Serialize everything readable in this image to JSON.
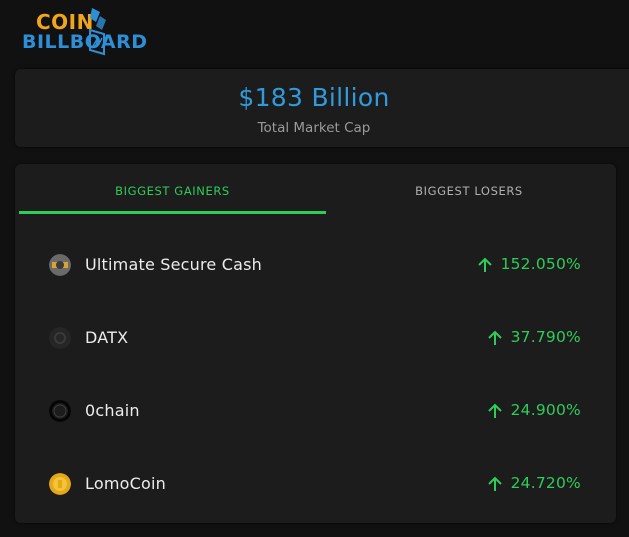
{
  "logo": {
    "line1": "COIN",
    "line2": "BILLBOARD",
    "brand_colors": {
      "top": "#f0a51a",
      "bottom": "#2d8fd8"
    }
  },
  "market_cap": {
    "value": "$183 Billion",
    "label": "Total Market Cap",
    "value_color": "#2f9bdc"
  },
  "tabs": [
    {
      "label": "BIGGEST GAINERS",
      "active": true
    },
    {
      "label": "BIGGEST LOSERS",
      "active": false
    }
  ],
  "gainers": [
    {
      "name": "Ultimate Secure Cash",
      "change": "152.050%",
      "icon": "ultimate-secure-cash-coin-icon"
    },
    {
      "name": "DATX",
      "change": "37.790%",
      "icon": "datx-coin-icon"
    },
    {
      "name": "0chain",
      "change": "24.900%",
      "icon": "0chain-coin-icon"
    },
    {
      "name": "LomoCoin",
      "change": "24.720%",
      "icon": "lomocoin-coin-icon"
    }
  ],
  "colors": {
    "positive": "#2ecc59",
    "background": "#111111",
    "card": "#1c1c1c"
  }
}
